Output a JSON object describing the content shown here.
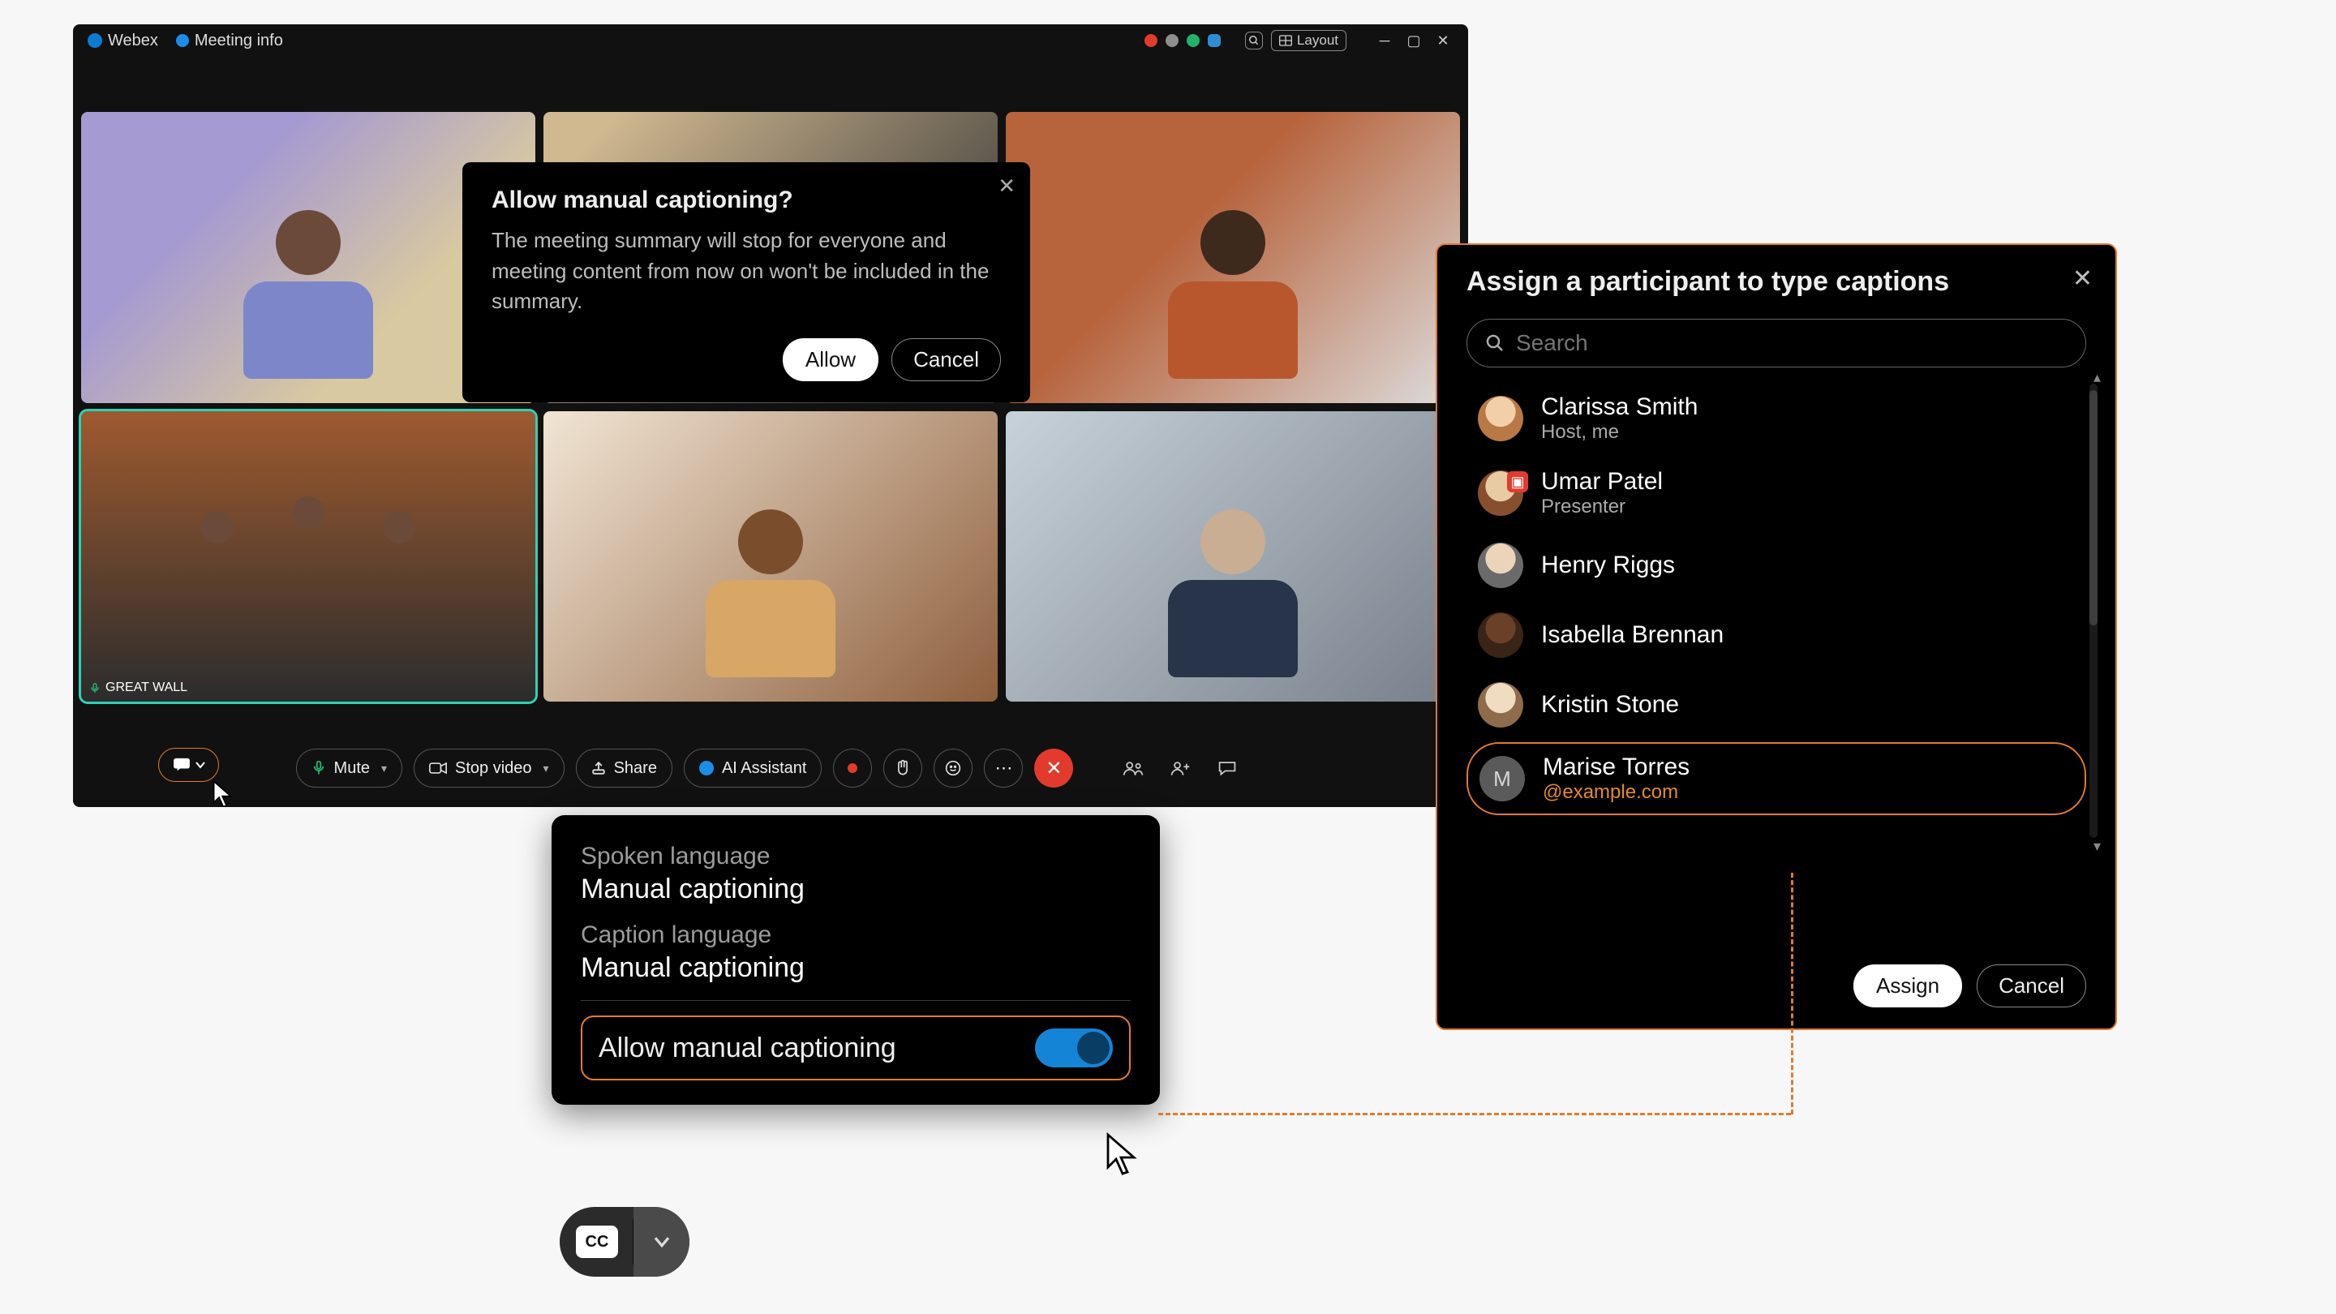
{
  "titlebar": {
    "brand": "Webex",
    "meeting_info": "Meeting info",
    "status_dots": [
      "#e23b2e",
      "#8e8e8e",
      "#22b36b",
      "#2c8fd6"
    ],
    "layout_label": "Layout"
  },
  "tiles": {
    "active_label": "GREAT WALL"
  },
  "allow_dialog": {
    "title": "Allow manual captioning?",
    "body": "The meeting summary will stop for everyone and meeting content from now on won't be included in the summary.",
    "allow": "Allow",
    "cancel": "Cancel"
  },
  "controls": {
    "mute": "Mute",
    "stop_video": "Stop video",
    "share": "Share",
    "ai_assistant": "AI Assistant"
  },
  "lang_pop": {
    "spoken_label": "Spoken language",
    "spoken_value": "Manual captioning",
    "caption_label": "Caption language",
    "caption_value": "Manual captioning",
    "toggle_label": "Allow manual captioning"
  },
  "cc_capsule": {
    "cc": "CC"
  },
  "assign": {
    "title": "Assign a participant to type captions",
    "search_placeholder": "Search",
    "assign": "Assign",
    "cancel": "Cancel",
    "participants": [
      {
        "name": "Clarissa Smith",
        "sub": "Host, me",
        "avatar": "av-a"
      },
      {
        "name": "Umar Patel",
        "sub": "Presenter",
        "avatar": "av-b",
        "presenter": true
      },
      {
        "name": "Henry Riggs",
        "sub": "",
        "avatar": "av-c"
      },
      {
        "name": "Isabella Brennan",
        "sub": "",
        "avatar": "av-d"
      },
      {
        "name": "Kristin Stone",
        "sub": "",
        "avatar": "av-e"
      },
      {
        "name": "Marise Torres",
        "sub": "@example.com",
        "avatar": "letter",
        "letter": "M",
        "selected": true,
        "sub_orange": true
      }
    ]
  }
}
